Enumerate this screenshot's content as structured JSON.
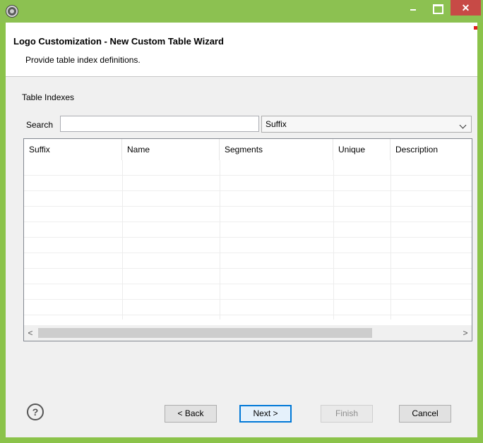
{
  "titlebar": {
    "close_label": "✕"
  },
  "wizard": {
    "title": "Logo Customization - New Custom Table Wizard",
    "description": "Provide table index definitions."
  },
  "section": {
    "label": "Table Indexes"
  },
  "search": {
    "label": "Search",
    "value": "",
    "placeholder": "",
    "column_selected": "Suffix"
  },
  "table": {
    "columns": [
      "Suffix",
      "Name",
      "Segments",
      "Unique",
      "Description"
    ],
    "rows": []
  },
  "scrollbar": {
    "left_arrow": "<",
    "right_arrow": ">"
  },
  "buttons": {
    "help": "?",
    "back": "< Back",
    "next": "Next >",
    "finish": "Finish",
    "cancel": "Cancel"
  },
  "icons": [
    "app-icon",
    "minimize-icon",
    "maximize-icon",
    "close-icon",
    "help-icon",
    "chevron-down-icon"
  ],
  "colors": {
    "frame": "#8cc151",
    "close": "#c74a46",
    "accent": "#0078d7"
  }
}
